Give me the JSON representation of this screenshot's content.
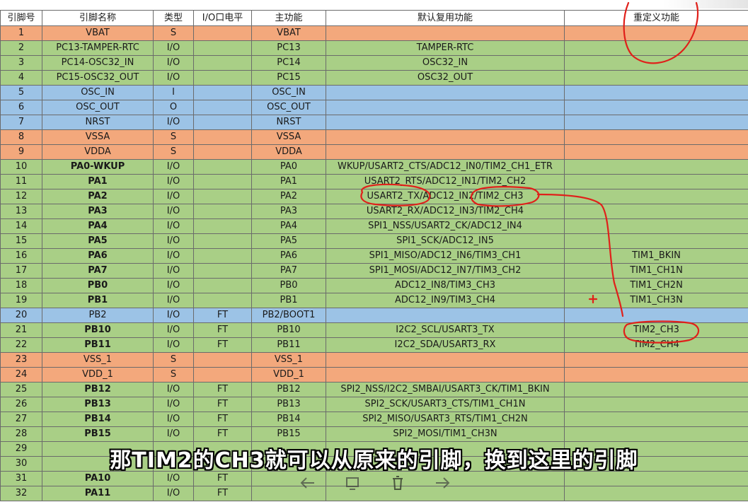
{
  "header": {
    "pin_no": "引脚号",
    "pin_name": "引脚名称",
    "type": "类型",
    "io_level": "I/O口电平",
    "main_function": "主功能",
    "default_alt": "默认复用功能",
    "remap": "重定义功能"
  },
  "rows": [
    {
      "no": "1",
      "name": "VBAT",
      "bold": false,
      "type": "S",
      "level": "",
      "main": "VBAT",
      "alt": "",
      "remap": "",
      "color": "orange"
    },
    {
      "no": "2",
      "name": "PC13-TAMPER-RTC",
      "bold": false,
      "type": "I/O",
      "level": "",
      "main": "PC13",
      "alt": "TAMPER-RTC",
      "remap": "",
      "color": "green"
    },
    {
      "no": "3",
      "name": "PC14-OSC32_IN",
      "bold": false,
      "type": "I/O",
      "level": "",
      "main": "PC14",
      "alt": "OSC32_IN",
      "remap": "",
      "color": "green"
    },
    {
      "no": "4",
      "name": "PC15-OSC32_OUT",
      "bold": false,
      "type": "I/O",
      "level": "",
      "main": "PC15",
      "alt": "OSC32_OUT",
      "remap": "",
      "color": "green"
    },
    {
      "no": "5",
      "name": "OSC_IN",
      "bold": false,
      "type": "I",
      "level": "",
      "main": "OSC_IN",
      "alt": "",
      "remap": "",
      "color": "blue"
    },
    {
      "no": "6",
      "name": "OSC_OUT",
      "bold": false,
      "type": "O",
      "level": "",
      "main": "OSC_OUT",
      "alt": "",
      "remap": "",
      "color": "blue"
    },
    {
      "no": "7",
      "name": "NRST",
      "bold": false,
      "type": "I/O",
      "level": "",
      "main": "NRST",
      "alt": "",
      "remap": "",
      "color": "blue"
    },
    {
      "no": "8",
      "name": "VSSA",
      "bold": false,
      "type": "S",
      "level": "",
      "main": "VSSA",
      "alt": "",
      "remap": "",
      "color": "orange"
    },
    {
      "no": "9",
      "name": "VDDA",
      "bold": false,
      "type": "S",
      "level": "",
      "main": "VDDA",
      "alt": "",
      "remap": "",
      "color": "orange"
    },
    {
      "no": "10",
      "name": "PA0-WKUP",
      "bold": true,
      "type": "I/O",
      "level": "",
      "main": "PA0",
      "alt": "WKUP/USART2_CTS/ADC12_IN0/TIM2_CH1_ETR",
      "remap": "",
      "color": "green"
    },
    {
      "no": "11",
      "name": "PA1",
      "bold": true,
      "type": "I/O",
      "level": "",
      "main": "PA1",
      "alt": "USART2_RTS/ADC12_IN1/TIM2_CH2",
      "remap": "",
      "color": "green"
    },
    {
      "no": "12",
      "name": "PA2",
      "bold": true,
      "type": "I/O",
      "level": "",
      "main": "PA2",
      "alt": "USART2_TX/ADC12_IN2/TIM2_CH3",
      "remap": "",
      "color": "green"
    },
    {
      "no": "13",
      "name": "PA3",
      "bold": true,
      "type": "I/O",
      "level": "",
      "main": "PA3",
      "alt": "USART2_RX/ADC12_IN3/TIM2_CH4",
      "remap": "",
      "color": "green"
    },
    {
      "no": "14",
      "name": "PA4",
      "bold": true,
      "type": "I/O",
      "level": "",
      "main": "PA4",
      "alt": "SPI1_NSS/USART2_CK/ADC12_IN4",
      "remap": "",
      "color": "green"
    },
    {
      "no": "15",
      "name": "PA5",
      "bold": true,
      "type": "I/O",
      "level": "",
      "main": "PA5",
      "alt": "SPI1_SCK/ADC12_IN5",
      "remap": "",
      "color": "green"
    },
    {
      "no": "16",
      "name": "PA6",
      "bold": true,
      "type": "I/O",
      "level": "",
      "main": "PA6",
      "alt": "SPI1_MISO/ADC12_IN6/TIM3_CH1",
      "remap": "TIM1_BKIN",
      "color": "green"
    },
    {
      "no": "17",
      "name": "PA7",
      "bold": true,
      "type": "I/O",
      "level": "",
      "main": "PA7",
      "alt": "SPI1_MOSI/ADC12_IN7/TIM3_CH2",
      "remap": "TIM1_CH1N",
      "color": "green"
    },
    {
      "no": "18",
      "name": "PB0",
      "bold": true,
      "type": "I/O",
      "level": "",
      "main": "PB0",
      "alt": "ADC12_IN8/TIM3_CH3",
      "remap": "TIM1_CH2N",
      "color": "green"
    },
    {
      "no": "19",
      "name": "PB1",
      "bold": true,
      "type": "I/O",
      "level": "",
      "main": "PB1",
      "alt": "ADC12_IN9/TIM3_CH4",
      "remap": "TIM1_CH3N",
      "color": "green"
    },
    {
      "no": "20",
      "name": "PB2",
      "bold": false,
      "type": "I/O",
      "level": "FT",
      "main": "PB2/BOOT1",
      "alt": "",
      "remap": "",
      "color": "blue"
    },
    {
      "no": "21",
      "name": "PB10",
      "bold": true,
      "type": "I/O",
      "level": "FT",
      "main": "PB10",
      "alt": "I2C2_SCL/USART3_TX",
      "remap": "TIM2_CH3",
      "color": "green"
    },
    {
      "no": "22",
      "name": "PB11",
      "bold": true,
      "type": "I/O",
      "level": "FT",
      "main": "PB11",
      "alt": "I2C2_SDA/USART3_RX",
      "remap": "TIM2_CH4",
      "color": "green"
    },
    {
      "no": "23",
      "name": "VSS_1",
      "bold": false,
      "type": "S",
      "level": "",
      "main": "VSS_1",
      "alt": "",
      "remap": "",
      "color": "orange"
    },
    {
      "no": "24",
      "name": "VDD_1",
      "bold": false,
      "type": "S",
      "level": "",
      "main": "VDD_1",
      "alt": "",
      "remap": "",
      "color": "orange"
    },
    {
      "no": "25",
      "name": "PB12",
      "bold": true,
      "type": "I/O",
      "level": "FT",
      "main": "PB12",
      "alt": "SPI2_NSS/I2C2_SMBAI/USART3_CK/TIM1_BKIN",
      "remap": "",
      "color": "green"
    },
    {
      "no": "26",
      "name": "PB13",
      "bold": true,
      "type": "I/O",
      "level": "FT",
      "main": "PB13",
      "alt": "SPI2_SCK/USART3_CTS/TIM1_CH1N",
      "remap": "",
      "color": "green"
    },
    {
      "no": "27",
      "name": "PB14",
      "bold": true,
      "type": "I/O",
      "level": "FT",
      "main": "PB14",
      "alt": "SPI2_MISO/USART3_RTS/TIM1_CH2N",
      "remap": "",
      "color": "green"
    },
    {
      "no": "28",
      "name": "PB15",
      "bold": true,
      "type": "I/O",
      "level": "FT",
      "main": "PB15",
      "alt": "SPI2_MOSI/TIM1_CH3N",
      "remap": "",
      "color": "green"
    },
    {
      "no": "29",
      "name": "",
      "bold": true,
      "type": "",
      "level": "",
      "main": "",
      "alt": "",
      "remap": "",
      "color": "green"
    },
    {
      "no": "30",
      "name": "",
      "bold": true,
      "type": "",
      "level": "",
      "main": "",
      "alt": "",
      "remap": "",
      "color": "green"
    },
    {
      "no": "31",
      "name": "PA10",
      "bold": true,
      "type": "I/O",
      "level": "FT",
      "main": "",
      "alt": "",
      "remap": "",
      "color": "green"
    },
    {
      "no": "32",
      "name": "PA11",
      "bold": true,
      "type": "I/O",
      "level": "FT",
      "main": "",
      "alt": "",
      "remap": "",
      "color": "green"
    }
  ],
  "subtitle": "那TIM2的CH3就可以从原来的引脚，换到这里的引脚",
  "controls": {
    "icons": [
      "back-arrow-icon",
      "share-icon",
      "trash-icon",
      "forward-arrow-icon"
    ]
  },
  "colors": {
    "orange": "#f3a87c",
    "green": "#a9cf86",
    "blue": "#9cc3e6",
    "annotation": "#e0201a"
  }
}
